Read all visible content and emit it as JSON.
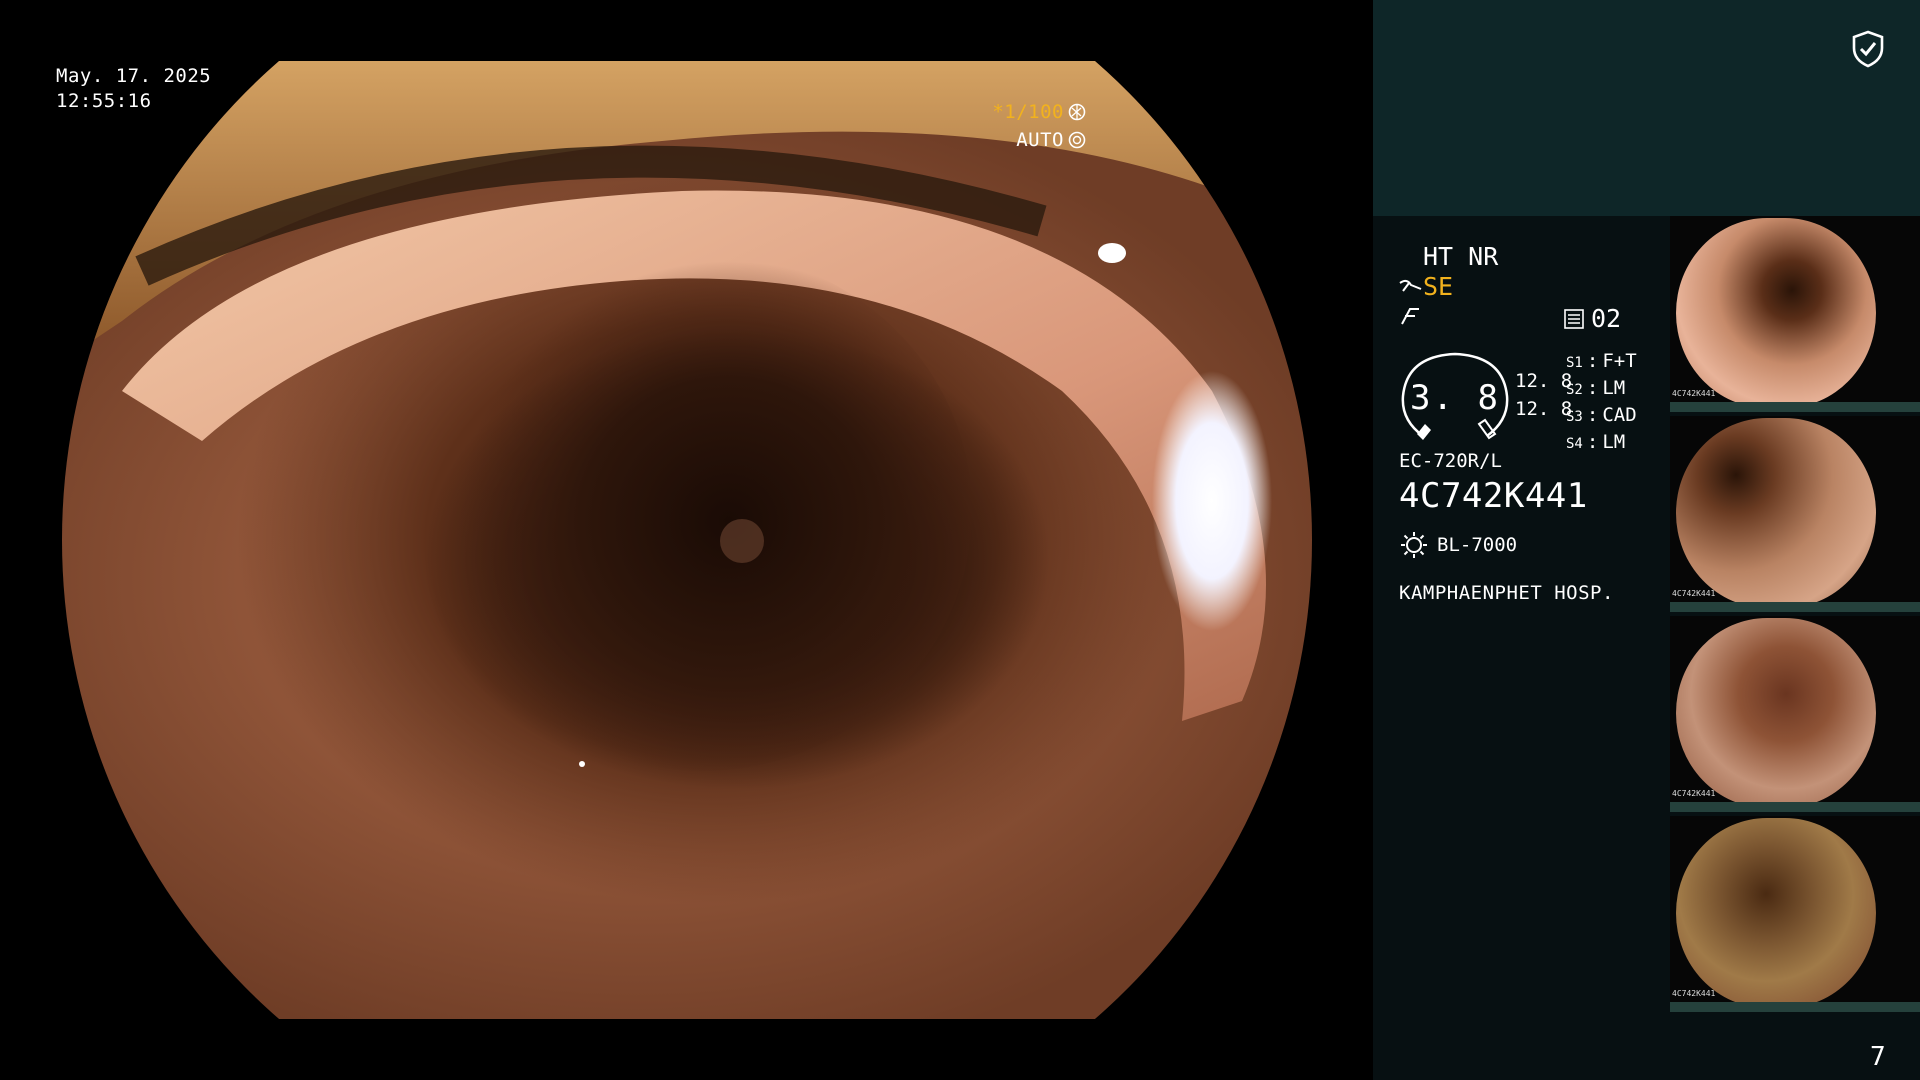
{
  "overlay": {
    "date": "May. 17. 2025",
    "time": "12:55:16",
    "shutter": "*1/100",
    "iris_mode": "AUTO"
  },
  "panel": {
    "modes": "HT NR",
    "se_label": "SE",
    "slot_number": "02",
    "gauge_value": "3. 8",
    "gauge_sub_top": "12. 8",
    "gauge_sub_bottom": "12. 8",
    "slots": [
      {
        "key": "S1",
        "value": "F+T"
      },
      {
        "key": "S2",
        "value": "LM"
      },
      {
        "key": "S3",
        "value": "CAD"
      },
      {
        "key": "S4",
        "value": "LM"
      }
    ],
    "scope_model": "EC-720R/L",
    "scope_serial": "4C742K441",
    "light_source": "BL-7000",
    "hospital": "KAMPHAENPHET HOSP.",
    "thumbnail_serial": "4C742K441",
    "page_number": "7"
  },
  "colors": {
    "accent": "#f2b21d",
    "panel_top": "#0e2628",
    "panel_bg": "#071012"
  },
  "icons": {
    "shield": "shield-check-icon",
    "aperture": "aperture-icon",
    "iris": "iris-icon",
    "light": "light-bulb-icon"
  }
}
